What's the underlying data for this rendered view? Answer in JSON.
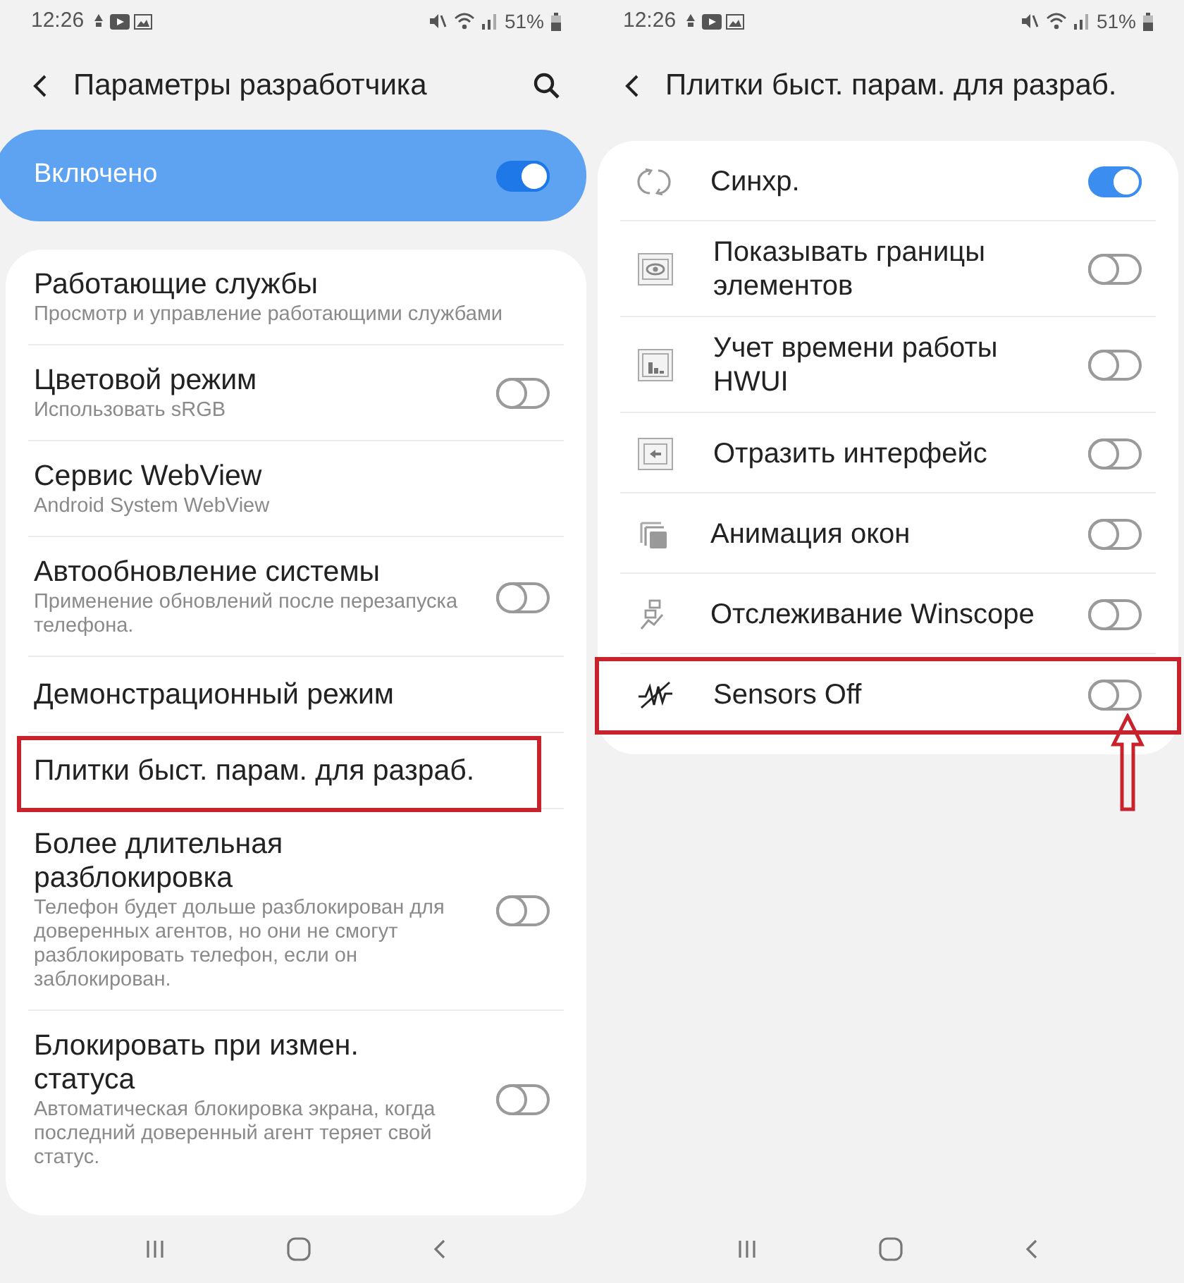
{
  "screens": [
    {
      "status_bar": {
        "time": "12:26",
        "battery": "51%"
      },
      "header": {
        "title": "Параметры разработчика",
        "search": true
      },
      "master_switch": {
        "label": "Включено",
        "on": true
      },
      "items": [
        {
          "kind": "setting",
          "title": "Работающие службы",
          "subtitle": "Просмотр и управление работающими службами",
          "highlighted": false
        },
        {
          "kind": "switch",
          "title": "Цветовой режим",
          "subtitle": "Использовать sRGB",
          "on": false,
          "highlighted": false
        },
        {
          "kind": "setting",
          "title": "Сервис WebView",
          "subtitle": "Android System WebView",
          "highlighted": false
        },
        {
          "kind": "switch",
          "title": "Автообновление системы",
          "subtitle": "Применение обновлений после перезапуска телефона.",
          "on": false,
          "highlighted": false
        },
        {
          "kind": "setting",
          "title": "Демонстрационный режим",
          "highlighted": false
        },
        {
          "kind": "setting",
          "title": "Плитки быст. парам. для разраб.",
          "highlighted": true
        },
        {
          "kind": "switch",
          "title": "Более длительная разблокировка",
          "subtitle": "Телефон будет дольше разблокирован для доверенных агентов, но они не смогут разблокировать телефон, если он заблокирован.",
          "on": false,
          "highlighted": false
        },
        {
          "kind": "switch",
          "title": "Блокировать при измен. статуса",
          "subtitle": "Автоматическая блокировка экрана, когда последний доверенный агент теряет свой статус.",
          "on": false,
          "highlighted": false
        }
      ]
    },
    {
      "status_bar": {
        "time": "12:26",
        "battery": "51%"
      },
      "header": {
        "title": "Плитки быст. парам. для разраб.",
        "search": false
      },
      "items": [
        {
          "kind": "tile",
          "title": "Синхр.",
          "on": true,
          "highlighted": false
        },
        {
          "kind": "tile",
          "title": "Показывать границы элементов",
          "on": false,
          "highlighted": false
        },
        {
          "kind": "tile",
          "title": "Учет времени работы HWUI",
          "on": false,
          "highlighted": false
        },
        {
          "kind": "tile",
          "title": "Отразить интерфейс",
          "on": false,
          "highlighted": false
        },
        {
          "kind": "tile",
          "title": "Анимация окон",
          "on": false,
          "highlighted": false
        },
        {
          "kind": "tile",
          "title": "Отслеживание Winscope",
          "on": false,
          "highlighted": false
        },
        {
          "kind": "tile",
          "title": "Sensors Off",
          "on": false,
          "highlighted": true
        }
      ]
    }
  ]
}
